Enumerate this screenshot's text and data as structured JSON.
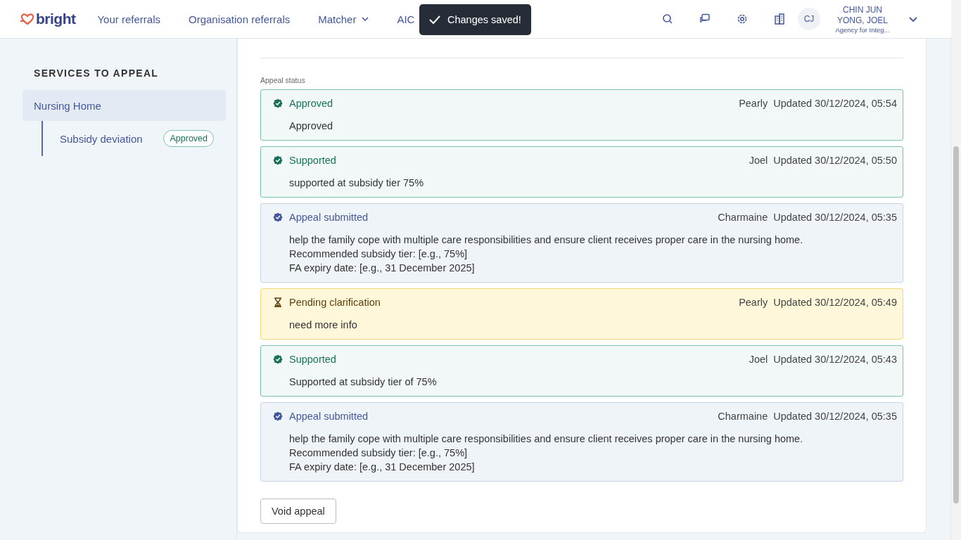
{
  "nav": {
    "logo": "bright",
    "links": [
      {
        "label": "Your referrals",
        "dropdown": false
      },
      {
        "label": "Organisation referrals",
        "dropdown": false
      },
      {
        "label": "Matcher",
        "dropdown": true
      },
      {
        "label": "AIC",
        "dropdown": false
      }
    ],
    "user": {
      "initials": "CJ",
      "name": "CHIN JUN YONG, JOEL",
      "organisation": "Agency for Integ..."
    }
  },
  "toast": {
    "message": "Changes saved!"
  },
  "sidebar": {
    "heading": "SERVICES TO APPEAL",
    "items": [
      {
        "label": "Nursing Home",
        "selected": true,
        "children": [
          {
            "label": "Subsidy deviation",
            "badge": "Approved"
          }
        ]
      }
    ]
  },
  "appeal": {
    "status_label": "Appeal status",
    "entries": [
      {
        "kind": "approved",
        "status": "Approved",
        "author": "Pearly",
        "updated": "Updated 30/12/2024, 05:54",
        "lines": [
          "Approved"
        ]
      },
      {
        "kind": "approved",
        "status": "Supported",
        "author": "Joel",
        "updated": "Updated 30/12/2024, 05:50",
        "lines": [
          "supported at subsidy tier 75%"
        ]
      },
      {
        "kind": "submitted",
        "status": "Appeal submitted",
        "author": "Charmaine",
        "updated": "Updated 30/12/2024, 05:35",
        "lines": [
          "help the family cope with multiple care responsibilities and ensure client receives proper care in the nursing home.",
          "Recommended subsidy tier: [e.g., 75%]",
          "FA expiry date: [e.g., 31 December 2025]"
        ]
      },
      {
        "kind": "pending",
        "status": "Pending clarification",
        "author": "Pearly",
        "updated": "Updated 30/12/2024, 05:49",
        "lines": [
          "need more info"
        ]
      },
      {
        "kind": "approved",
        "status": "Supported",
        "author": "Joel",
        "updated": "Updated 30/12/2024, 05:43",
        "lines": [
          "Supported at subsidy tier of 75%"
        ]
      },
      {
        "kind": "submitted",
        "status": "Appeal submitted",
        "author": "Charmaine",
        "updated": "Updated 30/12/2024, 05:35",
        "lines": [
          "help the family cope with multiple care responsibilities and ensure client receives proper care in the nursing home.",
          "Recommended subsidy tier: [e.g., 75%]",
          "FA expiry date: [e.g., 31 December 2025]"
        ]
      }
    ],
    "void_button": "Void appeal"
  }
}
